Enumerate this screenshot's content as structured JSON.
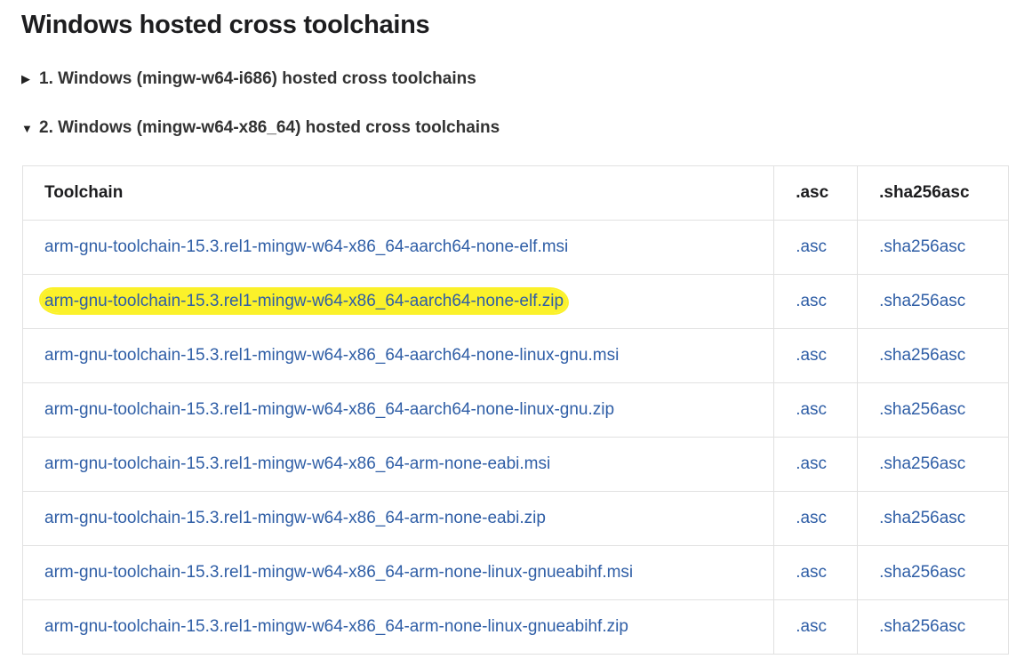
{
  "heading": "Windows hosted cross toolchains",
  "sections": [
    {
      "toggle_icon": "triangle-right",
      "label": "1. Windows (mingw-w64-i686) hosted cross toolchains",
      "expanded": false
    },
    {
      "toggle_icon": "triangle-down",
      "label": "2. Windows (mingw-w64-x86_64) hosted cross toolchains",
      "expanded": true
    }
  ],
  "table": {
    "headers": [
      "Toolchain",
      ".asc",
      ".sha256asc"
    ],
    "rows": [
      {
        "toolchain": "arm-gnu-toolchain-15.3.rel1-mingw-w64-x86_64-aarch64-none-elf.msi",
        "asc": ".asc",
        "sha": ".sha256asc",
        "highlighted": false
      },
      {
        "toolchain": "arm-gnu-toolchain-15.3.rel1-mingw-w64-x86_64-aarch64-none-elf.zip",
        "asc": ".asc",
        "sha": ".sha256asc",
        "highlighted": true
      },
      {
        "toolchain": "arm-gnu-toolchain-15.3.rel1-mingw-w64-x86_64-aarch64-none-linux-gnu.msi",
        "asc": ".asc",
        "sha": ".sha256asc",
        "highlighted": false
      },
      {
        "toolchain": "arm-gnu-toolchain-15.3.rel1-mingw-w64-x86_64-aarch64-none-linux-gnu.zip",
        "asc": ".asc",
        "sha": ".sha256asc",
        "highlighted": false
      },
      {
        "toolchain": "arm-gnu-toolchain-15.3.rel1-mingw-w64-x86_64-arm-none-eabi.msi",
        "asc": ".asc",
        "sha": ".sha256asc",
        "highlighted": false
      },
      {
        "toolchain": "arm-gnu-toolchain-15.3.rel1-mingw-w64-x86_64-arm-none-eabi.zip",
        "asc": ".asc",
        "sha": ".sha256asc",
        "highlighted": false
      },
      {
        "toolchain": "arm-gnu-toolchain-15.3.rel1-mingw-w64-x86_64-arm-none-linux-gnueabihf.msi",
        "asc": ".asc",
        "sha": ".sha256asc",
        "highlighted": false
      },
      {
        "toolchain": "arm-gnu-toolchain-15.3.rel1-mingw-w64-x86_64-arm-none-linux-gnueabihf.zip",
        "asc": ".asc",
        "sha": ".sha256asc",
        "highlighted": false
      }
    ]
  },
  "colors": {
    "link": "#2f5ea6",
    "highlight": "#fbf12a",
    "border": "#e1e1e1"
  }
}
